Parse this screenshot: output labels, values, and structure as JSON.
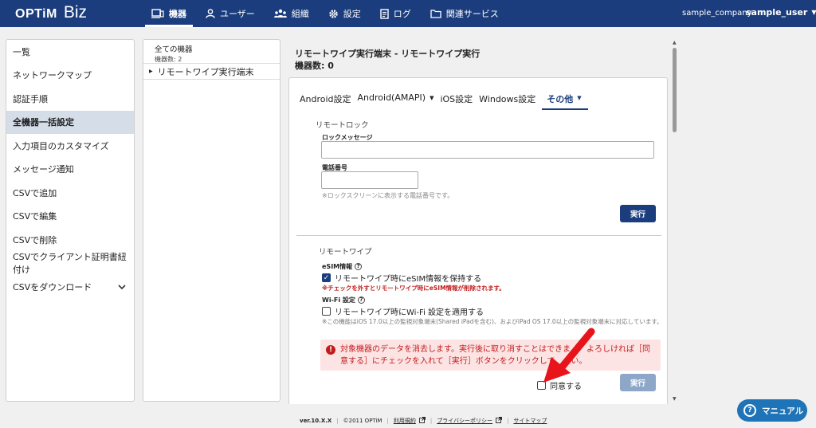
{
  "header": {
    "logo_main": "OPTiM",
    "logo_sub": "Biz",
    "nav": [
      {
        "label": "機器",
        "icon": "device-icon",
        "active": true
      },
      {
        "label": "ユーザー",
        "icon": "user-icon",
        "active": false
      },
      {
        "label": "組織",
        "icon": "organization-icon",
        "active": false
      },
      {
        "label": "設定",
        "icon": "gear-icon",
        "active": false
      },
      {
        "label": "ログ",
        "icon": "log-icon",
        "active": false
      },
      {
        "label": "関連サービス",
        "icon": "folder-icon",
        "active": false
      }
    ],
    "company": "sample_company",
    "user": "sample_user"
  },
  "sidebar": {
    "items": [
      {
        "label": "一覧"
      },
      {
        "label": "ネットワークマップ"
      },
      {
        "label": "認証手順"
      },
      {
        "label": "全機器一括設定",
        "active": true
      },
      {
        "label": "入力項目のカスタマイズ"
      },
      {
        "label": "メッセージ通知"
      },
      {
        "label": "CSVで追加"
      },
      {
        "label": "CSVで編集"
      },
      {
        "label": "CSVで削除"
      },
      {
        "label": "CSVでクライアント証明書紐付け"
      },
      {
        "label": "CSVをダウンロード"
      }
    ]
  },
  "tree": {
    "root_label": "全ての機器",
    "root_count": "機器数: 2",
    "node_label": "リモートワイプ実行端末"
  },
  "main": {
    "title": "リモートワイプ実行端末 - リモートワイプ実行",
    "count": "機器数: 0",
    "tabs": [
      {
        "label": "Android設定"
      },
      {
        "label": "Android(AMAPI)"
      },
      {
        "label": "iOS設定"
      },
      {
        "label": "Windows設定"
      },
      {
        "label": "その他"
      }
    ],
    "remote_lock": {
      "section_label": "リモートロック",
      "message_label": "ロックメッセージ",
      "message_value": "",
      "phone_label": "電話番号",
      "phone_value": "",
      "phone_hint": "※ロックスクリーンに表示する電話番号です。",
      "execute_label": "実行"
    },
    "remote_wipe": {
      "section_label": "リモートワイプ",
      "esim_label": "eSIM情報",
      "esim_checkbox_label": "リモートワイプ時にeSIM情報を保持する",
      "esim_checked": true,
      "esim_warning": "※チェックを外すとリモートワイプ時にeSIM情報が削除されます。",
      "wifi_label": "Wi-Fi 設定",
      "wifi_checkbox_label": "リモートワイプ時にWi-Fi 設定を適用する",
      "wifi_checked": false,
      "wifi_note": "※この機能はiOS 17.0以上の監視対象端末(Shared iPadを含む)、およびiPad OS 17.0以上の監視対象端末に対応しています。",
      "alert_text": "対象機器のデータを消去します。実行後に取り消すことはできま　　よろしければ［同意する］にチェックを入れて［実行］ボタンをクリックして　　い。",
      "agree_label": "同意する",
      "agree_checked": false,
      "execute_label": "実行"
    }
  },
  "footer": {
    "version": "ver.10.X.X",
    "copyright": "©2011 OPTiM",
    "terms": "利用規約",
    "privacy": "プライバシーポリシー",
    "sitemap": "サイトマップ"
  },
  "manual_button": "マニュアル",
  "colors": {
    "header_bg": "#1b3d7d",
    "accent": "#1b3d7d",
    "warning": "#c21d1d",
    "alert_bg": "#fde4e4",
    "annotation_arrow": "#e8141b",
    "manual_button": "#1f73b7"
  }
}
